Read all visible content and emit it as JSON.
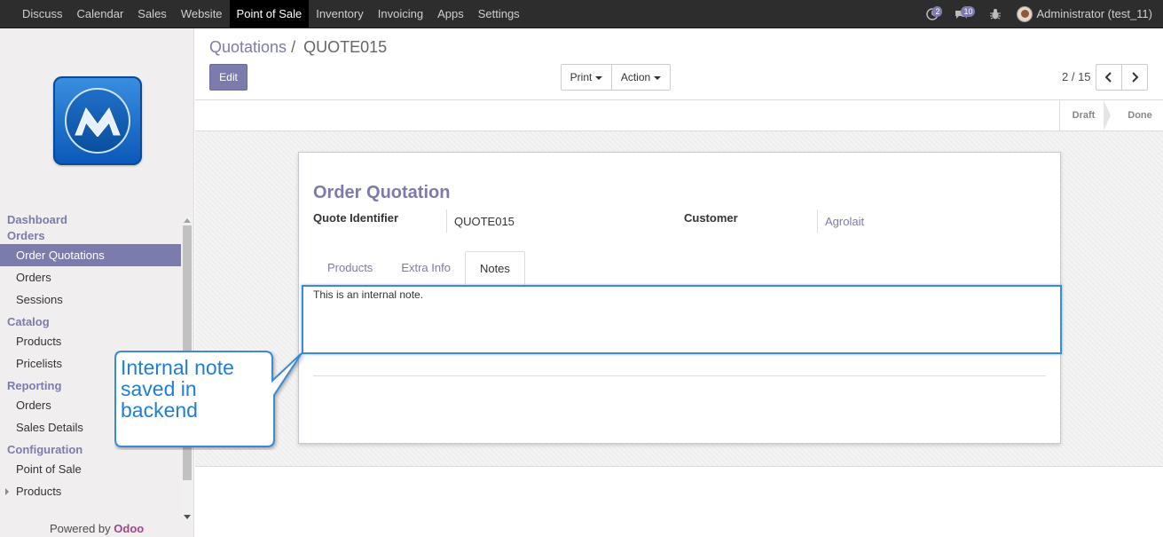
{
  "topbar": {
    "menu": [
      "Discuss",
      "Calendar",
      "Sales",
      "Website",
      "Point of Sale",
      "Inventory",
      "Invoicing",
      "Apps",
      "Settings"
    ],
    "active_menu": "Point of Sale",
    "messages_count": "2",
    "chat_count": "10",
    "user": "Administrator (test_11)"
  },
  "sidebar": {
    "sections": [
      {
        "head": "Dashboard",
        "items": []
      },
      {
        "head": "Orders",
        "items": [
          "Order Quotations",
          "Orders",
          "Sessions"
        ]
      },
      {
        "head": "Catalog",
        "items": [
          "Products",
          "Pricelists"
        ]
      },
      {
        "head": "Reporting",
        "items": [
          "Orders",
          "Sales Details"
        ]
      },
      {
        "head": "Configuration",
        "items": [
          "Point of Sale",
          "Products"
        ]
      }
    ],
    "active_item": "Order Quotations",
    "powered_by": "Powered by",
    "powered_brand": "Odoo"
  },
  "control": {
    "breadcrumb_parent": "Quotations",
    "breadcrumb_sep": "/",
    "breadcrumb_current": "QUOTE015",
    "edit_label": "Edit",
    "print_label": "Print",
    "action_label": "Action",
    "pager": "2 / 15"
  },
  "status": {
    "stages": [
      "Draft",
      "Done"
    ]
  },
  "form": {
    "title": "Order Quotation",
    "quote_id_label": "Quote Identifier",
    "quote_id_value": "QUOTE015",
    "customer_label": "Customer",
    "customer_value": "Agrolait",
    "tabs": [
      "Products",
      "Extra Info",
      "Notes"
    ],
    "active_tab": "Notes",
    "note": "This is an internal note."
  },
  "callout": {
    "text": "Internal note saved in backend",
    "color": "#1e7fd4"
  },
  "colors": {
    "accent": "#7c7bad",
    "topbar": "#2d2d2d",
    "highlight": "#3a8ad6"
  }
}
